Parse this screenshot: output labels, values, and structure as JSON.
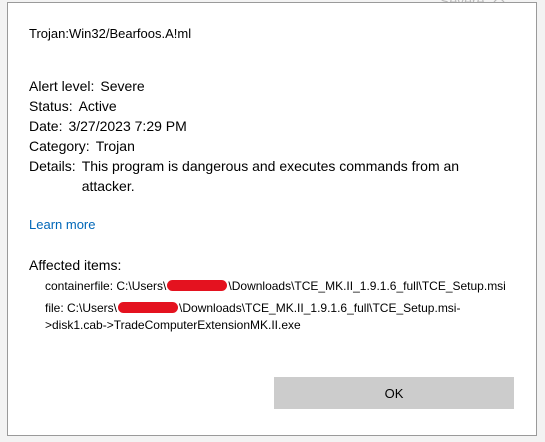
{
  "background": {
    "severity_label": "Severe",
    "chevron_icon": "chevron-up-icon"
  },
  "dialog": {
    "threat_name": "Trojan:Win32/Bearfoos.A!ml",
    "fields": {
      "alert_level": {
        "label": "Alert level:",
        "value": "Severe"
      },
      "status": {
        "label": "Status:",
        "value": "Active"
      },
      "date": {
        "label": "Date:",
        "value": "3/27/2023 7:29 PM"
      },
      "category": {
        "label": "Category:",
        "value": "Trojan"
      },
      "details": {
        "label": "Details:",
        "value": "This program is dangerous and executes commands from an attacker."
      }
    },
    "learn_more": "Learn more",
    "affected_items_label": "Affected items:",
    "affected_items": [
      {
        "prefix": "containerfile: C:\\Users\\",
        "suffix": "\\Downloads\\TCE_MK.II_1.9.1.6_full\\TCE_Setup.msi"
      },
      {
        "prefix": "file: C:\\Users\\",
        "suffix": "\\Downloads\\TCE_MK.II_1.9.1.6_full\\TCE_Setup.msi->disk1.cab->TradeComputerExtensionMK.II.exe"
      }
    ],
    "redaction_color": "#e4121f",
    "ok_label": "OK"
  }
}
